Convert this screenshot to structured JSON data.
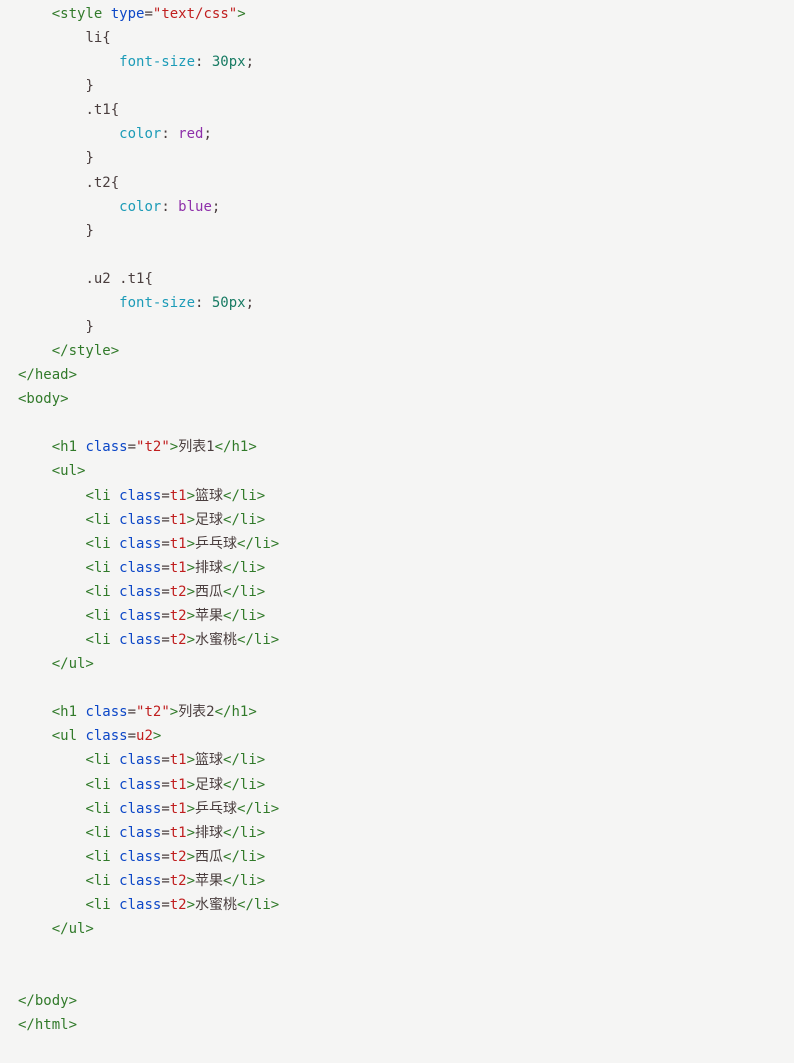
{
  "lines": {
    "l00_a": "<style",
    "l00_b": " type",
    "l00_c": "=",
    "l00_d": "\"text/css\"",
    "l00_e": ">",
    "l01": "li{",
    "l02_a": "font-size",
    "l02_b": ":",
    "l02_c": " 30px",
    "l02_d": ";",
    "l03": "}",
    "l04": ".t1{",
    "l05_a": "color",
    "l05_b": ":",
    "l05_c": " red",
    "l05_d": ";",
    "l06": "}",
    "l07": ".t2{",
    "l08_a": "color",
    "l08_b": ":",
    "l08_c": " blue",
    "l08_d": ";",
    "l09": "}",
    "l10": ".u2 .t1{",
    "l11_a": "font-size",
    "l11_b": ":",
    "l11_c": " 50px",
    "l11_d": ";",
    "l12": "}",
    "l13": "</style>",
    "l14": "</head>",
    "l15": "<body>",
    "l16_a": "<h1",
    "l16_b": " class",
    "l16_c": "=",
    "l16_d": "\"t2\"",
    "l16_e": ">",
    "l16_f": "列表1",
    "l16_g": "</h1>",
    "l17": "<ul>",
    "r1_a": "<li",
    "r1_b": " class",
    "r1_eq": "=",
    "r1_c": "t1",
    "r1_d": ">",
    "r1_e": "篮球",
    "r1_f": "</li>",
    "r2_a": "<li",
    "r2_b": " class",
    "r2_eq": "=",
    "r2_c": "t1",
    "r2_d": ">",
    "r2_e": "足球",
    "r2_f": "</li>",
    "r3_a": "<li",
    "r3_b": " class",
    "r3_eq": "=",
    "r3_c": "t1",
    "r3_d": ">",
    "r3_e": "乒乓球",
    "r3_f": "</li>",
    "r4_a": "<li",
    "r4_b": " class",
    "r4_eq": "=",
    "r4_c": "t1",
    "r4_d": ">",
    "r4_e": "排球",
    "r4_f": "</li>",
    "r5_a": "<li",
    "r5_b": " class",
    "r5_eq": "=",
    "r5_c": "t2",
    "r5_d": ">",
    "r5_e": "西瓜",
    "r5_f": "</li>",
    "r6_a": "<li",
    "r6_b": " class",
    "r6_eq": "=",
    "r6_c": "t2",
    "r6_d": ">",
    "r6_e": "苹果",
    "r6_f": "</li>",
    "r7_a": "<li",
    "r7_b": " class",
    "r7_eq": "=",
    "r7_c": "t2",
    "r7_d": ">",
    "r7_e": "水蜜桃",
    "r7_f": "</li>",
    "l18": "</ul>",
    "l19_a": "<h1",
    "l19_b": " class",
    "l19_c": "=",
    "l19_d": "\"t2\"",
    "l19_e": ">",
    "l19_f": "列表2",
    "l19_g": "</h1>",
    "l20_a": "<ul",
    "l20_b": " class",
    "l20_eq": "=",
    "l20_c": "u2",
    "l20_d": ">",
    "s1_a": "<li",
    "s1_b": " class",
    "s1_eq": "=",
    "s1_c": "t1",
    "s1_d": ">",
    "s1_e": "篮球",
    "s1_f": "</li>",
    "s2_a": "<li",
    "s2_b": " class",
    "s2_eq": "=",
    "s2_c": "t1",
    "s2_d": ">",
    "s2_e": "足球",
    "s2_f": "</li>",
    "s3_a": "<li",
    "s3_b": " class",
    "s3_eq": "=",
    "s3_c": "t1",
    "s3_d": ">",
    "s3_e": "乒乓球",
    "s3_f": "</li>",
    "s4_a": "<li",
    "s4_b": " class",
    "s4_eq": "=",
    "s4_c": "t1",
    "s4_d": ">",
    "s4_e": "排球",
    "s4_f": "</li>",
    "s5_a": "<li",
    "s5_b": " class",
    "s5_eq": "=",
    "s5_c": "t2",
    "s5_d": ">",
    "s5_e": "西瓜",
    "s5_f": "</li>",
    "s6_a": "<li",
    "s6_b": " class",
    "s6_eq": "=",
    "s6_c": "t2",
    "s6_d": ">",
    "s6_e": "苹果",
    "s6_f": "</li>",
    "s7_a": "<li",
    "s7_b": " class",
    "s7_eq": "=",
    "s7_c": "t2",
    "s7_d": ">",
    "s7_e": "水蜜桃",
    "s7_f": "</li>",
    "l21": "</ul>",
    "l22": "</body>",
    "l23": "</html>"
  }
}
